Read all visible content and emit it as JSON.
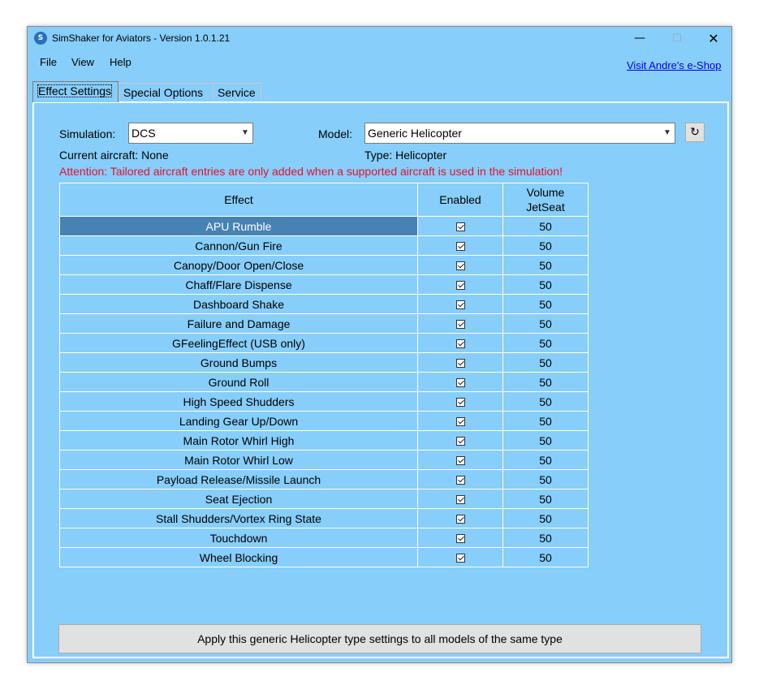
{
  "window": {
    "title": "SimShaker for Aviators  - Version 1.0.1.21",
    "controls": {
      "minimize": "—",
      "maximize": "☐",
      "close": "✕"
    }
  },
  "menu": {
    "items": [
      "File",
      "View",
      "Help"
    ],
    "link": "Visit Andre's e-Shop"
  },
  "tabs": [
    {
      "label": "Effect Settings",
      "active": true
    },
    {
      "label": "Special Options",
      "active": false
    },
    {
      "label": "Service",
      "active": false
    }
  ],
  "settings": {
    "simulation_label": "Simulation:",
    "simulation_value": "DCS",
    "model_label": "Model:",
    "model_value": "Generic Helicopter",
    "current_aircraft": "Current aircraft: None",
    "type": "Type: Helicopter",
    "attention": "Attention: Tailored aircraft entries are only added when a supported aircraft is used in the simulation!"
  },
  "table": {
    "headers": {
      "effect": "Effect",
      "enabled": "Enabled",
      "volume_line1": "Volume",
      "volume_line2": "JetSeat"
    },
    "rows": [
      {
        "effect": "APU Rumble",
        "enabled": true,
        "volume": "50",
        "selected": true
      },
      {
        "effect": "Cannon/Gun Fire",
        "enabled": true,
        "volume": "50"
      },
      {
        "effect": "Canopy/Door Open/Close",
        "enabled": true,
        "volume": "50"
      },
      {
        "effect": "Chaff/Flare Dispense",
        "enabled": true,
        "volume": "50"
      },
      {
        "effect": "Dashboard Shake",
        "enabled": true,
        "volume": "50"
      },
      {
        "effect": "Failure and Damage",
        "enabled": true,
        "volume": "50"
      },
      {
        "effect": "GFeelingEffect (USB only)",
        "enabled": true,
        "volume": "50"
      },
      {
        "effect": "Ground Bumps",
        "enabled": true,
        "volume": "50"
      },
      {
        "effect": "Ground Roll",
        "enabled": true,
        "volume": "50"
      },
      {
        "effect": "High Speed Shudders",
        "enabled": true,
        "volume": "50"
      },
      {
        "effect": "Landing Gear Up/Down",
        "enabled": true,
        "volume": "50"
      },
      {
        "effect": "Main Rotor Whirl High",
        "enabled": true,
        "volume": "50"
      },
      {
        "effect": "Main Rotor Whirl Low",
        "enabled": true,
        "volume": "50"
      },
      {
        "effect": "Payload Release/Missile Launch",
        "enabled": true,
        "volume": "50"
      },
      {
        "effect": "Seat Ejection",
        "enabled": true,
        "volume": "50"
      },
      {
        "effect": "Stall Shudders/Vortex Ring State",
        "enabled": true,
        "volume": "50"
      },
      {
        "effect": "Touchdown",
        "enabled": true,
        "volume": "50"
      },
      {
        "effect": "Wheel Blocking",
        "enabled": true,
        "volume": "50"
      }
    ]
  },
  "apply_button": "Apply this generic Helicopter type settings to all models of the same type",
  "colors": {
    "background": "#87cefa",
    "selected_row": "#4682b4",
    "attention": "#e8102a",
    "link": "#0000ee"
  }
}
